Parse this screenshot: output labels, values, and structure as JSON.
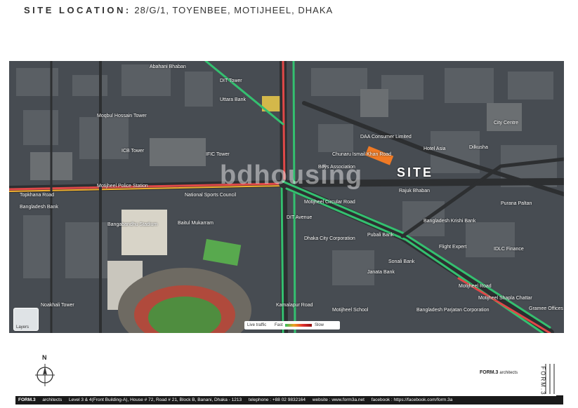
{
  "header": {
    "label": "SITE LOCATION:",
    "address": "28/G/1, TOYENBEE, MOTIJHEEL, DHAKA"
  },
  "map": {
    "site_label": "SITE",
    "watermark": "bdhousing",
    "layers_label": "Layers",
    "traffic": {
      "label": "Live traffic",
      "fast": "Fast",
      "slow": "Slow"
    },
    "places": [
      "DIT Tower",
      "Uttara Bank",
      "Abahani Bhaban",
      "Moqbul Hossain Tower",
      "ICB Tower",
      "IFIC Tower",
      "Motijheel Police Station",
      "Topkhana Road",
      "Bangladesh Bank",
      "National Sports Council",
      "Bangabandhu Stadium",
      "Baitul Mukarram",
      "DAA Consumer Limited",
      "Hotel Asia",
      "Boys Association",
      "Rajuk Bhaban",
      "Motijheel Circular Road",
      "DIT Avenue",
      "Flight Expert",
      "Sonali Bank",
      "Janata Bank",
      "Motijheel Road",
      "Motijheel Shapla Chattar",
      "Gramee Offices",
      "Chunaru Ismail Khan Road",
      "Purana Paltan",
      "Dilkusha",
      "Bangladesh Krishi Bank",
      "IDLC Finance",
      "Dhaka City Corporation",
      "Bangladesh Parjatan Corporation",
      "Motijheel School",
      "Pubali Bank",
      "Kamalapur Road",
      "Noakhali Tower",
      "City Centre"
    ]
  },
  "north_label": "N",
  "logo": {
    "name": "FORM.3",
    "suffix": "architects",
    "vertical": "FORM.3"
  },
  "footer": {
    "brand": "FORM.3",
    "brand_suffix": "architects",
    "address": "Level 3 & 4(Front Building-A), House # 72, Road # 21, Block B, Banani, Dhaka - 1213",
    "telephone": "telephone : +88 02 9832164",
    "website": "website : www.form3a.net",
    "facebook": "facebook : https://facebook.com/form.3a"
  }
}
